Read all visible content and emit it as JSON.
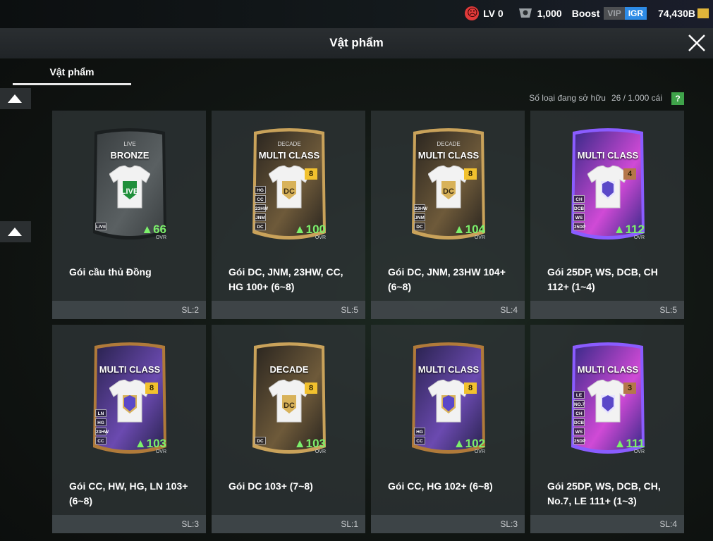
{
  "topbar": {
    "level": "LV 0",
    "points": "1,000",
    "boost": "Boost",
    "vip": "VIP",
    "igr": "IGR",
    "balance": "74,430B"
  },
  "header": {
    "title": "Vật phẩm"
  },
  "tabs": [
    {
      "label": "Vật phẩm",
      "active": true
    }
  ],
  "ownership": {
    "label": "Số loại đang sở hữu",
    "count": "26 / 1.000 cái",
    "help": "?"
  },
  "items": [
    {
      "name": "Gói cầu thủ Đồng",
      "qty": "SL:2",
      "card": {
        "style": "bronze",
        "sublabel": "LIVE",
        "label": "BRONZE",
        "ovr": "66",
        "rank": "",
        "shirt_badge": "LIVE",
        "positions": [
          "LIVE"
        ]
      }
    },
    {
      "name": "Gói DC, JNM, 23HW, CC, HG 100+ (6~8)",
      "qty": "SL:5",
      "card": {
        "style": "decade",
        "sublabel": "DECADE",
        "label": "MULTI CLASS",
        "ovr": "100",
        "rank": "8",
        "shirt_badge": "DC",
        "positions": [
          "HG",
          "CC",
          "23HW",
          "JNM",
          "DC"
        ]
      }
    },
    {
      "name": "Gói DC, JNM, 23HW 104+ (6~8)",
      "qty": "SL:4",
      "card": {
        "style": "decade",
        "sublabel": "DECADE",
        "label": "MULTI CLASS",
        "ovr": "104",
        "rank": "8",
        "shirt_badge": "DC",
        "positions": [
          "23HW",
          "JNM",
          "DC"
        ]
      }
    },
    {
      "name": "Gói 25DP, WS, DCB, CH 112+ (1~4)",
      "qty": "SL:5",
      "card": {
        "style": "purple",
        "sublabel": "",
        "label": "MULTI CLASS",
        "ovr": "112",
        "rank": "4",
        "shirt_badge": "",
        "positions": [
          "CH",
          "DCB",
          "WS",
          "25DP"
        ]
      }
    },
    {
      "name": "Gói CC, HW, HG, LN 103+ (6~8)",
      "qty": "SL:3",
      "card": {
        "style": "multi",
        "sublabel": "",
        "label": "MULTI CLASS",
        "ovr": "103",
        "rank": "8",
        "shirt_badge": "",
        "positions": [
          "LN",
          "HG",
          "23HW",
          "CC"
        ]
      }
    },
    {
      "name": "Gói DC 103+ (7~8)",
      "qty": "SL:1",
      "card": {
        "style": "decade",
        "sublabel": "",
        "label": "DECADE",
        "ovr": "103",
        "rank": "8",
        "shirt_badge": "DC",
        "positions": [
          "DC"
        ]
      }
    },
    {
      "name": "Gói CC, HG 102+ (6~8)",
      "qty": "SL:3",
      "card": {
        "style": "multi",
        "sublabel": "",
        "label": "MULTI CLASS",
        "ovr": "102",
        "rank": "8",
        "shirt_badge": "",
        "positions": [
          "HG",
          "CC"
        ]
      }
    },
    {
      "name": "Gói 25DP, WS, DCB, CH, No.7, LE 111+ (1~3)",
      "qty": "SL:4",
      "card": {
        "style": "purple",
        "sublabel": "",
        "label": "MULTI CLASS",
        "ovr": "111",
        "rank": "3",
        "shirt_badge": "",
        "positions": [
          "LE",
          "NO.7",
          "CH",
          "DCB",
          "WS",
          "25DP"
        ]
      }
    }
  ],
  "colors": {
    "ovr_green": "#7cf06b",
    "igr_blue": "#2d8be6",
    "help_green": "#3fa34a",
    "bronze_frame": "#2a2e30",
    "decade_frame": "#c9a25a",
    "purple_frame": "#8a5cff",
    "multi_frame": "#b07a3a"
  },
  "icons": {
    "level": "sad-face-icon",
    "points": "shield-badge-icon",
    "balance": "coin-icon",
    "close": "close-icon",
    "scroll_up": "triangle-up-icon"
  }
}
